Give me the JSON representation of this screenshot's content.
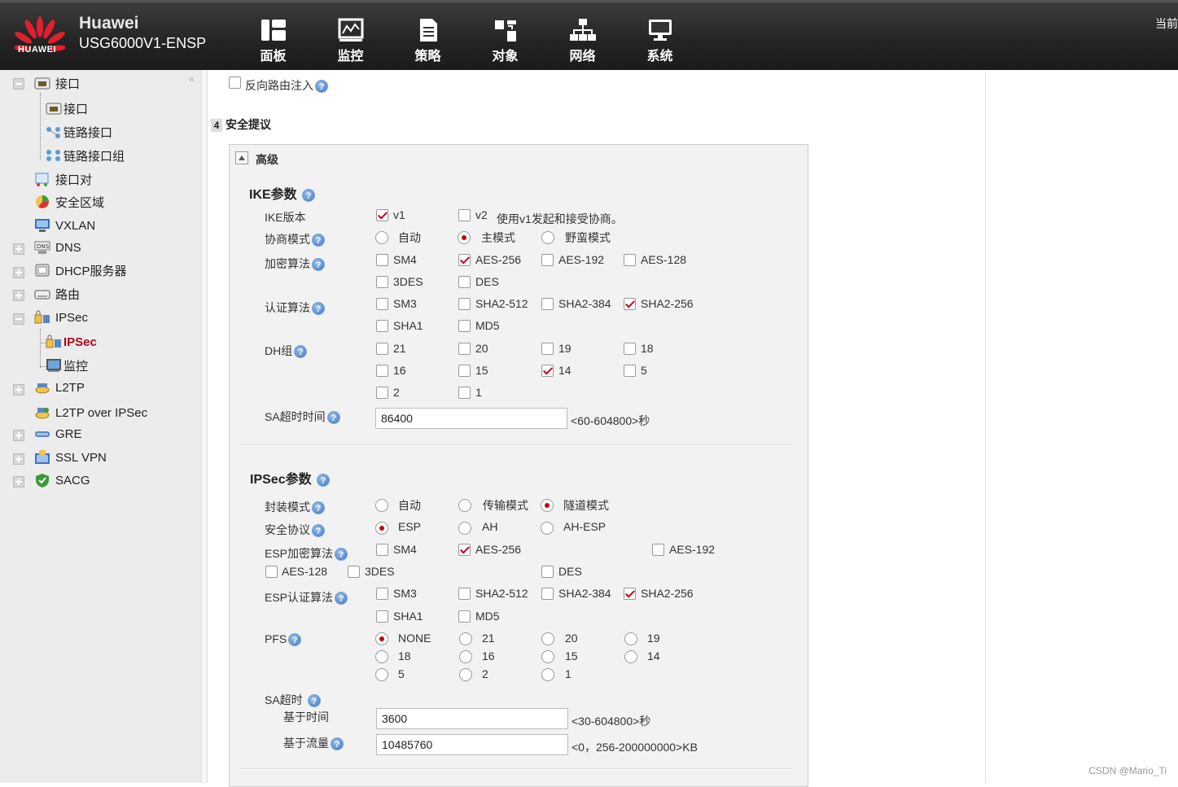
{
  "header": {
    "logo_text": "HUAWEI",
    "brand_line1": "Huawei",
    "brand_line2": "USG6000V1-ENSP",
    "nav": [
      "面板",
      "监控",
      "策略",
      "对象",
      "网络",
      "系统"
    ],
    "top_right": "当前"
  },
  "sidebar": {
    "items": [
      {
        "label": "接口"
      },
      {
        "label": "接口"
      },
      {
        "label": "链路接口"
      },
      {
        "label": "链路接口组"
      },
      {
        "label": "接口对"
      },
      {
        "label": "安全区域"
      },
      {
        "label": "VXLAN"
      },
      {
        "label": "DNS"
      },
      {
        "label": "DHCP服务器"
      },
      {
        "label": "路由"
      },
      {
        "label": "IPSec"
      },
      {
        "label": "IPSec"
      },
      {
        "label": "监控"
      },
      {
        "label": "L2TP"
      },
      {
        "label": "L2TP over IPSec"
      },
      {
        "label": "GRE"
      },
      {
        "label": "SSL VPN"
      },
      {
        "label": "SACG"
      }
    ]
  },
  "main": {
    "reverse_route": "反向路由注入",
    "step_num": "4",
    "section_title": "安全提议",
    "advanced": "高级",
    "ike": {
      "title": "IKE参数",
      "version_label": "IKE版本",
      "v1": "v1",
      "v2": "v2",
      "version_note": "使用v1发起和接受协商。",
      "mode_label": "协商模式",
      "mode_auto": "自动",
      "mode_main": "主模式",
      "mode_aggr": "野蛮模式",
      "enc_label": "加密算法",
      "enc": [
        "SM4",
        "AES-256",
        "AES-192",
        "AES-128",
        "3DES",
        "DES"
      ],
      "auth_label": "认证算法",
      "auth": [
        "SM3",
        "SHA2-512",
        "SHA2-384",
        "SHA2-256",
        "SHA1",
        "MD5"
      ],
      "dh_label": "DH组",
      "dh": [
        "21",
        "20",
        "19",
        "18",
        "16",
        "15",
        "14",
        "5",
        "2",
        "1"
      ],
      "sa_label": "SA超时时间",
      "sa_value": "86400",
      "sa_range": "<60-604800>秒"
    },
    "ipsec": {
      "title": "IPSec参数",
      "encap_label": "封装模式",
      "encap": [
        "自动",
        "传输模式",
        "隧道模式"
      ],
      "proto_label": "安全协议",
      "proto": [
        "ESP",
        "AH",
        "AH-ESP"
      ],
      "esp_enc_label": "ESP加密算法",
      "esp_enc": [
        "SM4",
        "AES-256",
        "AES-192",
        "AES-128",
        "3DES",
        "DES"
      ],
      "esp_auth_label": "ESP认证算法",
      "esp_auth": [
        "SM3",
        "SHA2-512",
        "SHA2-384",
        "SHA2-256",
        "SHA1",
        "MD5"
      ],
      "pfs_label": "PFS",
      "pfs": [
        "NONE",
        "21",
        "20",
        "19",
        "18",
        "16",
        "15",
        "14",
        "5",
        "2",
        "1"
      ],
      "sa_label": "SA超时",
      "time_label": "基于时间",
      "time_value": "3600",
      "time_range": "<30-604800>秒",
      "traffic_label": "基于流量",
      "traffic_value": "10485760",
      "traffic_range": "<0，256-200000000>KB"
    },
    "help_glyph": "?"
  },
  "watermark": "CSDN @Mario_Ti",
  "colors": {
    "accent": "#c4001a",
    "header": "#2a2a2a",
    "sidebar": "#ececec",
    "panel": "#f2f2f2"
  }
}
